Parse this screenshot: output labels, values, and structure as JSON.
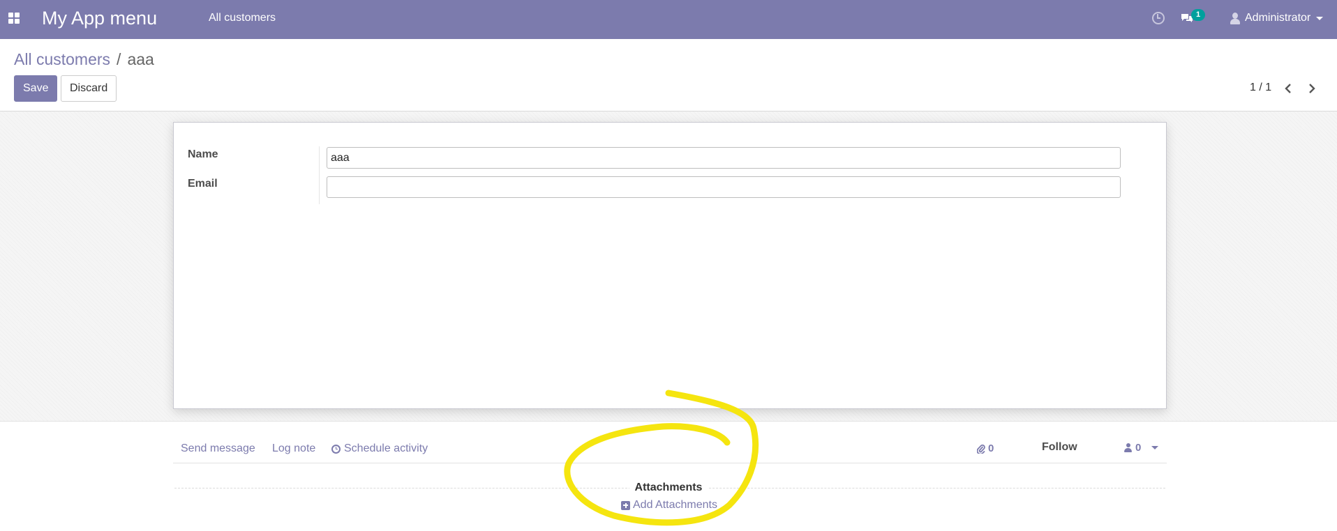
{
  "navbar": {
    "app_title": "My App menu",
    "menu_item": "All customers",
    "chat_badge": "1",
    "user_name": "Administrator"
  },
  "breadcrumb": {
    "parent": "All customers",
    "separator": "/",
    "current": "aaa"
  },
  "toolbar": {
    "save_label": "Save",
    "discard_label": "Discard",
    "pager_value": "1 / 1"
  },
  "form": {
    "name_label": "Name",
    "name_value": "aaa",
    "email_label": "Email",
    "email_value": ""
  },
  "chatter": {
    "send_message": "Send message",
    "log_note": "Log note",
    "schedule_activity": "Schedule activity",
    "attachment_count": "0",
    "follow_label": "Follow",
    "follower_count": "0",
    "attachments_title": "Attachments",
    "add_attachments": "Add Attachments"
  },
  "colors": {
    "brand": "#7c7bad",
    "badge": "#00a09d",
    "annotation": "#f5e50f"
  }
}
